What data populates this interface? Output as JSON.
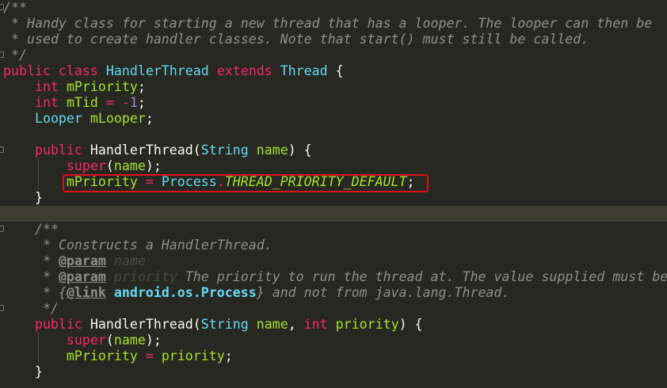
{
  "lines": [
    {
      "fold": true,
      "tokens": [
        {
          "t": "/**",
          "c": "c"
        }
      ]
    },
    {
      "tokens": [
        {
          "t": " * Handy class for starting a new thread that has a looper. The looper can then be",
          "c": "c"
        }
      ]
    },
    {
      "tokens": [
        {
          "t": " * used to create handler classes. Note that start() must still be called.",
          "c": "c"
        }
      ]
    },
    {
      "fold": true,
      "tokens": [
        {
          "t": " */",
          "c": "c"
        }
      ]
    },
    {
      "tokens": [
        {
          "t": "public class ",
          "c": "k"
        },
        {
          "t": "HandlerThread ",
          "c": "t"
        },
        {
          "t": "extends ",
          "c": "k"
        },
        {
          "t": "Thread ",
          "c": "t"
        },
        {
          "t": "{",
          "c": "w"
        }
      ]
    },
    {
      "tokens": [
        {
          "t": "    int ",
          "c": "k"
        },
        {
          "t": "mPriority",
          "c": "g"
        },
        {
          "t": ";",
          "c": "w"
        }
      ]
    },
    {
      "tokens": [
        {
          "t": "    int ",
          "c": "k"
        },
        {
          "t": "mTid ",
          "c": "g"
        },
        {
          "t": "= -",
          "c": "k"
        },
        {
          "t": "1",
          "c": "n"
        },
        {
          "t": ";",
          "c": "w"
        }
      ]
    },
    {
      "tokens": [
        {
          "t": "    Looper ",
          "c": "t"
        },
        {
          "t": "mLooper",
          "c": "g"
        },
        {
          "t": ";",
          "c": "w"
        }
      ]
    },
    {
      "tokens": []
    },
    {
      "fold": true,
      "tokens": [
        {
          "t": "    public ",
          "c": "k"
        },
        {
          "t": "HandlerThread(",
          "c": "w"
        },
        {
          "t": "String ",
          "c": "t"
        },
        {
          "t": "name",
          "c": "g"
        },
        {
          "t": ") {",
          "c": "w"
        }
      ]
    },
    {
      "tokens": [
        {
          "t": "        super",
          "c": "k"
        },
        {
          "t": "(",
          "c": "w"
        },
        {
          "t": "name",
          "c": "g"
        },
        {
          "t": ");",
          "c": "w"
        }
      ]
    },
    {
      "tokens": [
        {
          "t": "        mPriority ",
          "c": "g"
        },
        {
          "t": "= ",
          "c": "k"
        },
        {
          "t": "Process",
          "c": "t"
        },
        {
          "t": ".",
          "c": "k"
        },
        {
          "t": "THREAD_PRIORITY_DEFAULT",
          "c": "ci"
        },
        {
          "t": ";",
          "c": "w"
        }
      ]
    },
    {
      "tokens": [
        {
          "t": "    }",
          "c": "w"
        }
      ]
    },
    {
      "current": true,
      "tokens": []
    },
    {
      "fold": true,
      "tokens": [
        {
          "t": "    /**",
          "c": "c"
        }
      ]
    },
    {
      "tokens": [
        {
          "t": "     * Constructs a HandlerThread.",
          "c": "c"
        }
      ]
    },
    {
      "tokens": [
        {
          "t": "     * ",
          "c": "c"
        },
        {
          "t": "@param",
          "c": "dc"
        },
        {
          "t": " name",
          "c": "dp"
        }
      ]
    },
    {
      "tokens": [
        {
          "t": "     * ",
          "c": "c"
        },
        {
          "t": "@param",
          "c": "dc"
        },
        {
          "t": " priority",
          "c": "dp"
        },
        {
          "t": " The priority to run the thread at. The value supplied must be",
          "c": "c"
        }
      ]
    },
    {
      "tokens": [
        {
          "t": "     * {",
          "c": "c"
        },
        {
          "t": "@link",
          "c": "dc"
        },
        {
          "t": " android.os.Process",
          "c": "lk"
        },
        {
          "t": "} and not from java.lang.Thread.",
          "c": "c"
        }
      ]
    },
    {
      "fold": true,
      "tokens": [
        {
          "t": "     */",
          "c": "c"
        }
      ]
    },
    {
      "tokens": [
        {
          "t": "    public ",
          "c": "k"
        },
        {
          "t": "HandlerThread(",
          "c": "w"
        },
        {
          "t": "String ",
          "c": "t"
        },
        {
          "t": "name",
          "c": "g"
        },
        {
          "t": ", ",
          "c": "w"
        },
        {
          "t": "int ",
          "c": "k"
        },
        {
          "t": "priority",
          "c": "g"
        },
        {
          "t": ") {",
          "c": "w"
        }
      ]
    },
    {
      "tokens": [
        {
          "t": "        super",
          "c": "k"
        },
        {
          "t": "(",
          "c": "w"
        },
        {
          "t": "name",
          "c": "g"
        },
        {
          "t": ");",
          "c": "w"
        }
      ]
    },
    {
      "tokens": [
        {
          "t": "        mPriority ",
          "c": "g"
        },
        {
          "t": "= ",
          "c": "k"
        },
        {
          "t": "priority",
          "c": "g"
        },
        {
          "t": ";",
          "c": "w"
        }
      ]
    },
    {
      "tokens": [
        {
          "t": "    }",
          "c": "w"
        }
      ]
    }
  ],
  "colors": {
    "background": "#272822",
    "highlight_box": "#e0101a",
    "keyword": "#f92672",
    "type": "#66d9ef",
    "identifier": "#a6e22e"
  }
}
